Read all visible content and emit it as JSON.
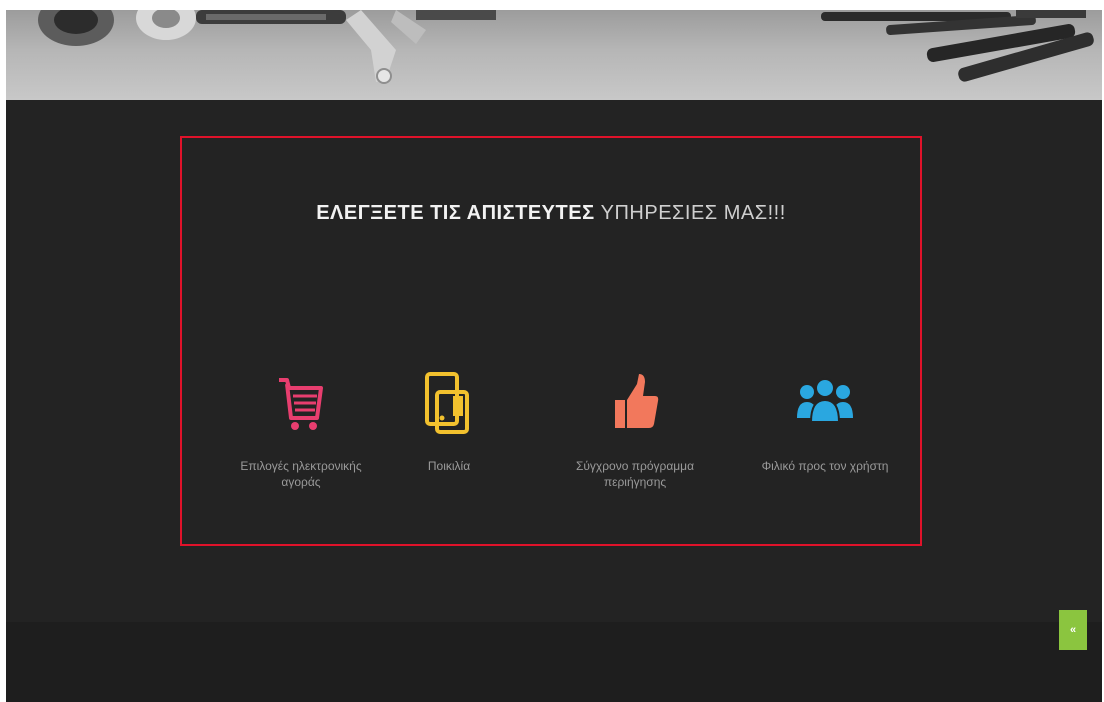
{
  "hero": {
    "image": "car-parts-banner"
  },
  "services": {
    "heading_bold": "ΕΛΕΓΞΕΤΕ ΤΙΣ ΑΠΙΣΤΕΥΤΕΣ",
    "heading_light": "ΥΠΗΡΕΣΙΕΣ ΜΑΣ!!!",
    "intro": "",
    "features": [
      {
        "icon": "shopping-cart-icon",
        "color": "#e83e6f",
        "label": "Επιλογές ηλεκτρονικής αγοράς"
      },
      {
        "icon": "tablet-icon",
        "color": "#f2c12e",
        "label": "Ποικιλία"
      },
      {
        "icon": "thumbs-up-icon",
        "color": "#f2785c",
        "label": "Σύγχρονο πρόγραμμα περιήγησης"
      },
      {
        "icon": "users-group-icon",
        "color": "#2aa7e0",
        "label": "Φιλικό προς τον χρήστη"
      }
    ]
  },
  "scroll_top": {
    "icon": "chevron-up-icon",
    "label": "«",
    "color": "#8bc53f"
  },
  "accent_color": "#e0122a"
}
